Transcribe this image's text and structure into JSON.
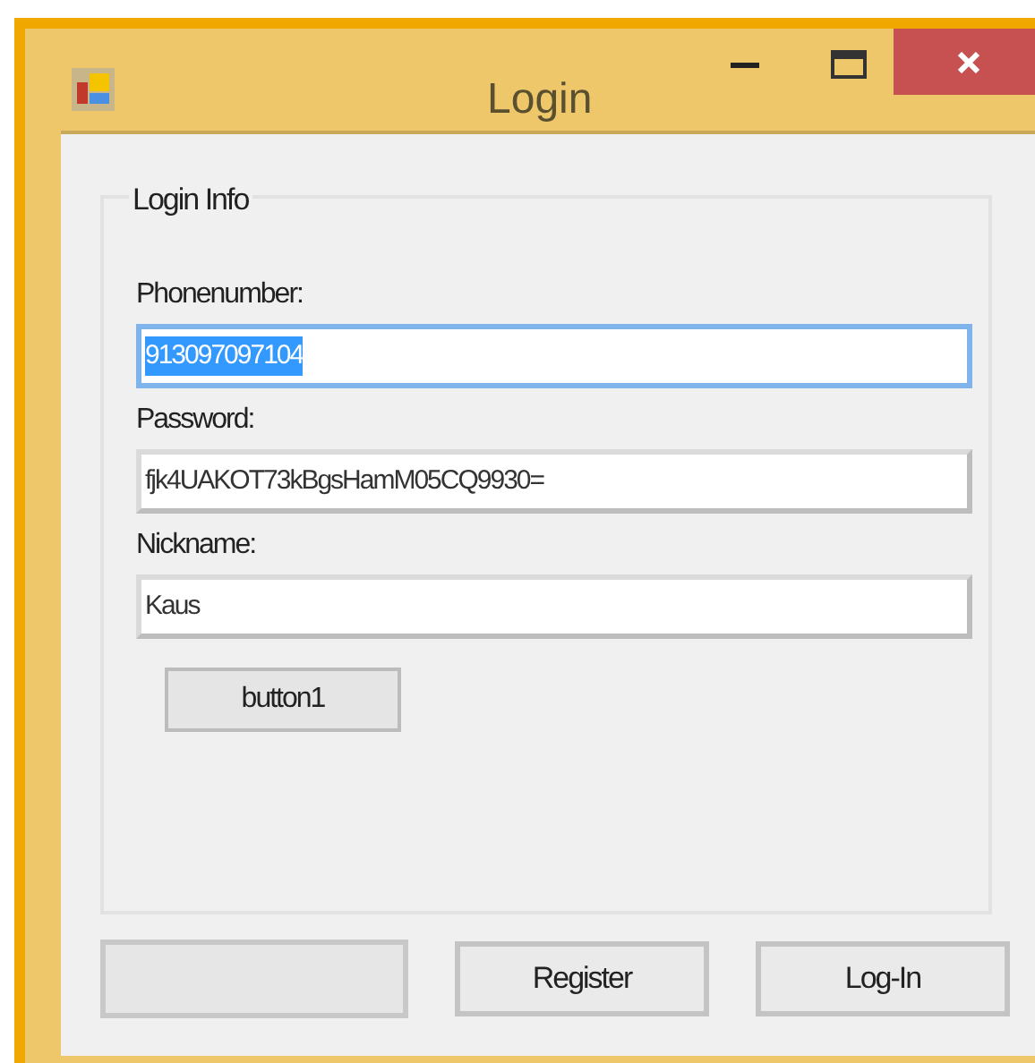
{
  "window": {
    "title": "Login",
    "controls": [
      {
        "kind": "minimize"
      },
      {
        "kind": "maximize"
      },
      {
        "kind": "close"
      }
    ]
  },
  "group": {
    "title": "Login Info",
    "fields": [
      {
        "label": "Phonenumber:",
        "value": "913097097104",
        "focused": true
      },
      {
        "label": "Password:",
        "value": "fjk4UAKOT73kBgsHamM05CQ9930=",
        "focused": false
      },
      {
        "label": "Nickname:",
        "value": "Kaus",
        "focused": false
      }
    ],
    "button": {
      "label": "button1"
    }
  },
  "buttons": [
    {
      "kind": "blank"
    },
    {
      "kind": "text",
      "label": "Register"
    },
    {
      "kind": "text",
      "label": "Log-In"
    }
  ]
}
